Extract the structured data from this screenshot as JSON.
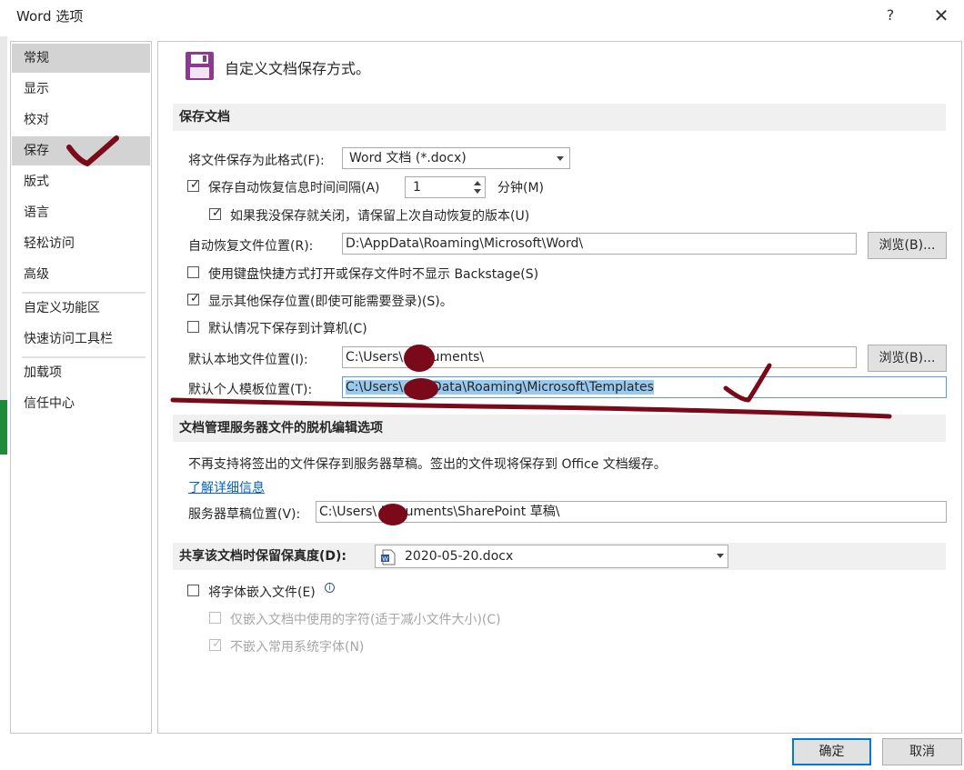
{
  "dialog": {
    "title": "Word 选项",
    "help": "?",
    "close": "✕"
  },
  "nav": {
    "items": [
      "常规",
      "显示",
      "校对",
      "保存",
      "版式",
      "语言",
      "轻松访问",
      "高级",
      "自定义功能区",
      "快速访问工具栏",
      "加载项",
      "信任中心"
    ],
    "selected_index": 0,
    "hover_index": 3
  },
  "header": {
    "icon": "floppy-disk-icon",
    "text": "自定义文档保存方式。"
  },
  "save_section": {
    "title": "保存文档",
    "format_label": "将文件保存为此格式(F):",
    "format_value": "Word 文档 (*.docx)",
    "autorecover_label": "保存自动恢复信息时间间隔(A)",
    "autorecover_checked": true,
    "autorecover_minutes": "1",
    "minutes_label": "分钟(M)",
    "keep_last_label": "如果我没保存就关闭，请保留上次自动恢复的版本(U)",
    "keep_last_checked": true,
    "autorecover_location_label": "自动恢复文件位置(R):",
    "autorecover_location_value": "D:\\AppData\\Roaming\\Microsoft\\Word\\",
    "browse_label": "浏览(B)...",
    "backstage_label": "使用键盘快捷方式打开或保存文件时不显示 Backstage(S)",
    "backstage_checked": false,
    "show_locations_label": "显示其他保存位置(即使可能需要登录)(S)。",
    "show_locations_checked": true,
    "save_to_computer_label": "默认情况下保存到计算机(C)",
    "save_to_computer_checked": false,
    "local_location_label": "默认本地文件位置(I):",
    "local_location_value": "C:\\Users\\      Documents\\",
    "browse2_label": "浏览(B)...",
    "template_location_label": "默认个人模板位置(T):",
    "template_location_value": "C:\\Users\\      AppData\\Roaming\\Microsoft\\Templates"
  },
  "offline_section": {
    "title": "文档管理服务器文件的脱机编辑选项",
    "notice": "不再支持将签出的文件保存到服务器草稿。签出的文件现将保存到 Office 文档缓存。",
    "learn_more": "了解详细信息",
    "drafts_label": "服务器草稿位置(V):",
    "drafts_value": "C:\\Users\\      Documents\\SharePoint 草稿\\"
  },
  "fidelity_section": {
    "title": "共享该文档时保留保真度(D):",
    "document": "2020-05-20.docx",
    "embed_fonts_label": "将字体嵌入文件(E)",
    "embed_fonts_checked": false,
    "embed_used_label": "仅嵌入文档中使用的字符(适于减小文件大小)(C)",
    "embed_used_checked": false,
    "no_common_label": "不嵌入常用系统字体(N)",
    "no_common_checked": true
  },
  "footer": {
    "ok": "确定",
    "cancel": "取消"
  },
  "colors": {
    "selected_nav": "#d3d3d3",
    "section_bar": "#f0f0f0",
    "accent": "#0078d7",
    "save_icon": "#8b3a8f",
    "annotation": "#7a0a1a"
  }
}
